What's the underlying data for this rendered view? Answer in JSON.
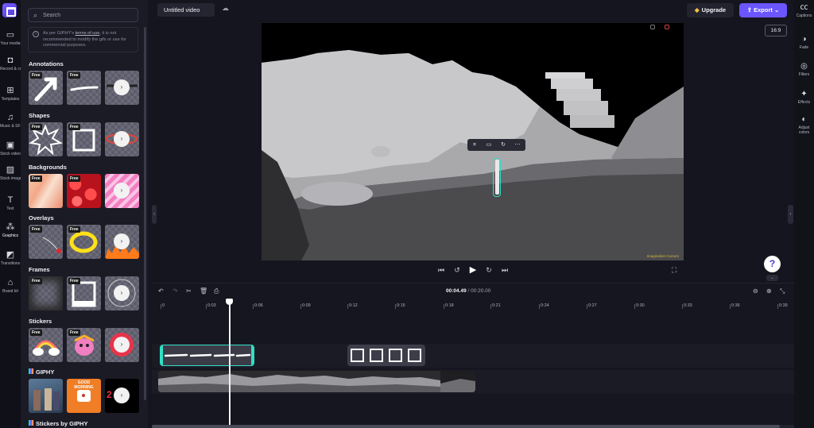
{
  "rail": {
    "items": [
      {
        "label": "Your media",
        "icon": "folder-icon"
      },
      {
        "label": "Record & create",
        "icon": "camera-icon"
      },
      {
        "label": "Templates",
        "icon": "templates-icon"
      },
      {
        "label": "Music & SFX",
        "icon": "music-icon"
      },
      {
        "label": "Stock video",
        "icon": "film-icon"
      },
      {
        "label": "Stock images",
        "icon": "image-icon"
      },
      {
        "label": "Text",
        "icon": "text-icon"
      },
      {
        "label": "Graphics",
        "icon": "shapes-icon"
      },
      {
        "label": "Transitions",
        "icon": "transitions-icon"
      },
      {
        "label": "Brand kit",
        "icon": "brand-kit-icon"
      }
    ],
    "active": "Graphics"
  },
  "panel": {
    "search_placeholder": "Search",
    "notice_pre": "As per GIPHY's ",
    "notice_link": "terms of use",
    "notice_post": ", it is not recommended to modify the gifs or use for commercial purposes.",
    "free_badge": "Free",
    "sections": {
      "annotations": "Annotations",
      "shapes": "Shapes",
      "backgrounds": "Backgrounds",
      "overlays": "Overlays",
      "frames": "Frames",
      "stickers": "Stickers",
      "giphy": "GIPHY",
      "stickers_giphy": "Stickers by GIPHY"
    },
    "giphy_tile_text": "GOOD MORNING"
  },
  "topbar": {
    "project_title": "Untitled video",
    "upgrade_label": "Upgrade",
    "export_label": "Export",
    "aspect_ratio": "16:9"
  },
  "right_rail": {
    "items": [
      "Captions",
      "Fade",
      "Filters",
      "Effects",
      "Adjust colors"
    ]
  },
  "preview": {
    "credit": "Imagination Cursors"
  },
  "timeline": {
    "current_time": "00:04.49",
    "total_time": "00:20.00",
    "ruler": [
      "0",
      "0:03",
      "0:06",
      "0:09",
      "0:12",
      "0:15",
      "0:18",
      "0:21",
      "0:24",
      "0:27",
      "0:30",
      "0:33",
      "0:36",
      "0:39"
    ]
  },
  "colors": {
    "accent": "#6a55ff",
    "selection": "#31e0c4",
    "upgrade_icon": "#f5c242"
  }
}
